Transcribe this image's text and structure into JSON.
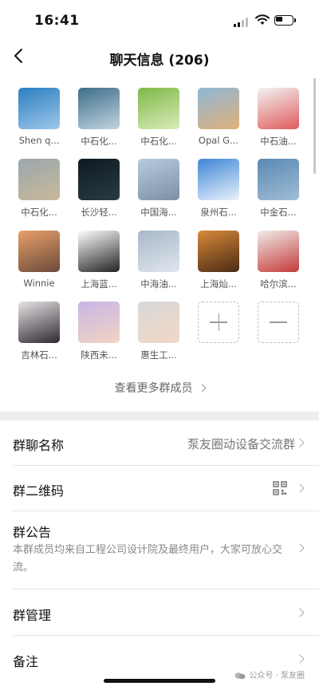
{
  "status": {
    "time": "16:41"
  },
  "nav": {
    "title": "聊天信息 (206)"
  },
  "members": [
    {
      "name": "Shen q...",
      "avatar": "group-photo-avatar",
      "colors": [
        "#2d7fc1",
        "#9cc7ea"
      ]
    },
    {
      "name": "中石化...",
      "avatar": "mountain-road-avatar",
      "colors": [
        "#3e6d8a",
        "#c2d4df"
      ]
    },
    {
      "name": "中石化...",
      "avatar": "grass-avatar",
      "colors": [
        "#7fb848",
        "#d9ecb8"
      ]
    },
    {
      "name": "Opal G...",
      "avatar": "sea-sunset-avatar",
      "colors": [
        "#8fb7d6",
        "#e0b07a"
      ]
    },
    {
      "name": "中石油...",
      "avatar": "cartoon-couple-avatar",
      "colors": [
        "#f3f3f3",
        "#e05b5b"
      ]
    },
    {
      "name": "中石化...",
      "avatar": "construction-site-avatar",
      "colors": [
        "#9aa7ad",
        "#c8b99a"
      ]
    },
    {
      "name": "长沙轻...",
      "avatar": "dark-emblem-avatar",
      "colors": [
        "#0d1a22",
        "#2b3a44"
      ]
    },
    {
      "name": "中国海...",
      "avatar": "cityscape-avatar",
      "colors": [
        "#b8cbe0",
        "#7b8fa5"
      ]
    },
    {
      "name": "泉州石...",
      "avatar": "blue-sky-lake-avatar",
      "colors": [
        "#3f86d6",
        "#e9f1fb"
      ]
    },
    {
      "name": "中金石...",
      "avatar": "river-city-avatar",
      "colors": [
        "#5b88b2",
        "#9fbdd6"
      ]
    },
    {
      "name": "Winnie",
      "avatar": "sunset-silhouette-avatar",
      "colors": [
        "#e8a06a",
        "#6b4a3a"
      ]
    },
    {
      "name": "上海蓝...",
      "avatar": "anime-girl-avatar",
      "colors": [
        "#ffffff",
        "#222222"
      ]
    },
    {
      "name": "中海油...",
      "avatar": "cloudy-sky-avatar",
      "colors": [
        "#a9b8c8",
        "#dfe6ee"
      ]
    },
    {
      "name": "上海灿...",
      "avatar": "tiger-avatar",
      "colors": [
        "#d88a3a",
        "#4a2a14"
      ]
    },
    {
      "name": "哈尔滨...",
      "avatar": "toy-figure-avatar",
      "colors": [
        "#f1ece8",
        "#c33a3a"
      ]
    },
    {
      "name": "吉林石...",
      "avatar": "anime-man-avatar",
      "colors": [
        "#e8e2e6",
        "#2e2a30"
      ]
    },
    {
      "name": "陕西未...",
      "avatar": "baby-purple-avatar",
      "colors": [
        "#c7b6e6",
        "#f3d3c1"
      ]
    },
    {
      "name": "惠生工...",
      "avatar": "baby-avatar",
      "colors": [
        "#d9d9d9",
        "#f2d7c6"
      ]
    }
  ],
  "add_button": {
    "name": "add-member-button"
  },
  "remove_button": {
    "name": "remove-member-button"
  },
  "more_members": "查看更多群成员",
  "settings": {
    "group_name_label": "群聊名称",
    "group_name_value": "泵友圈动设备交流群",
    "qr_label": "群二维码",
    "notice_label": "群公告",
    "notice_text": "本群成员均来自工程公司设计院及最终用户，大家可放心交流。",
    "manage_label": "群管理",
    "remark_label": "备注"
  },
  "watermark": "公众号 · 泵友圈"
}
